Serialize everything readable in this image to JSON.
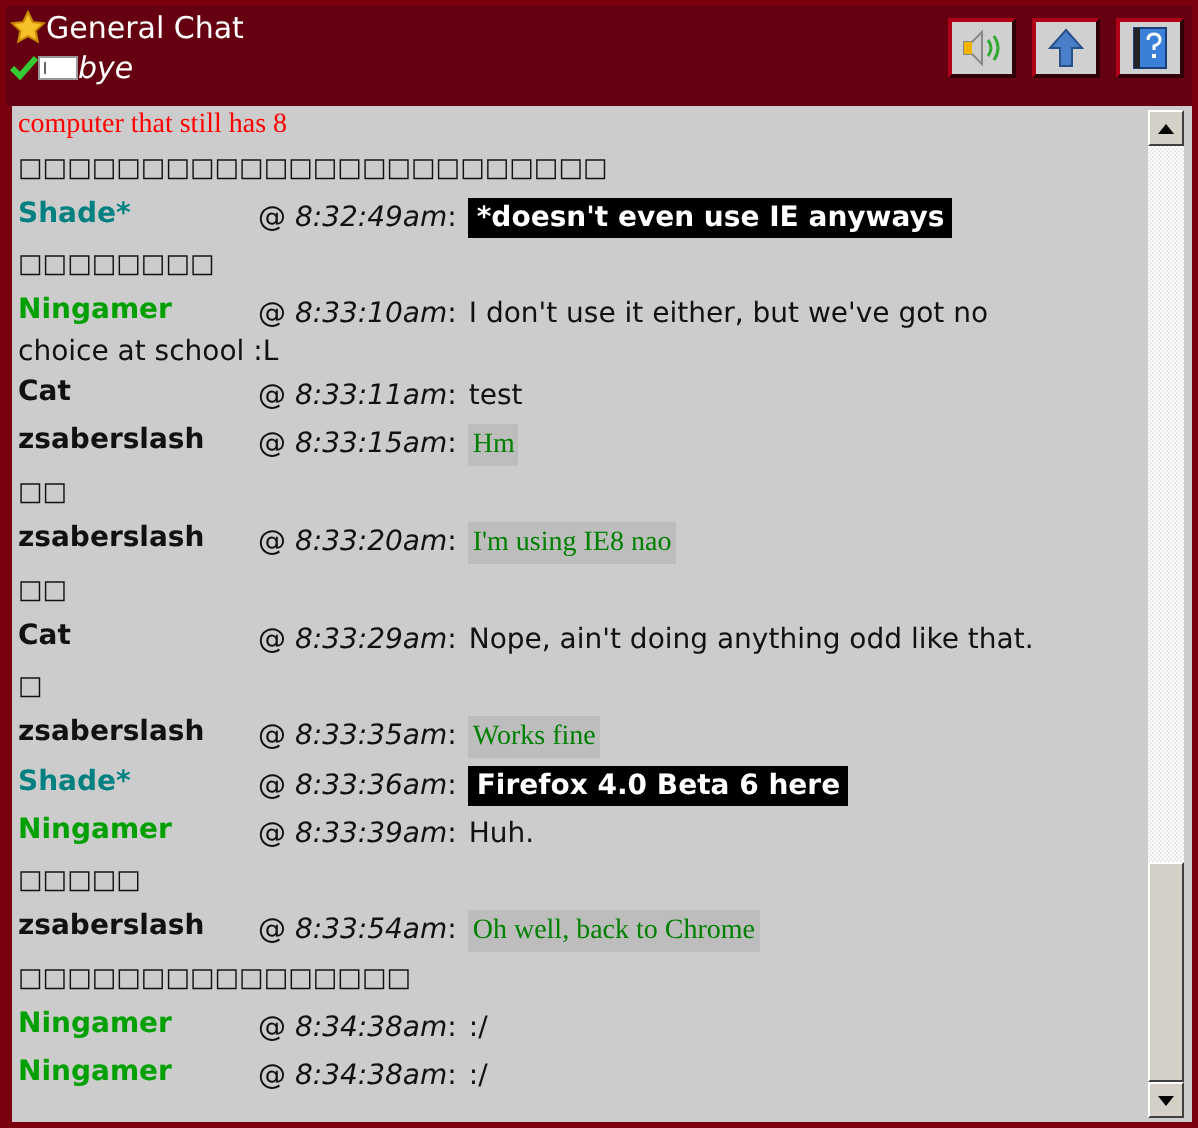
{
  "header": {
    "title": "General Chat",
    "status": {
      "online": true,
      "text": "bye"
    },
    "buttons": [
      {
        "kind": "sound"
      },
      {
        "kind": "up"
      },
      {
        "kind": "help"
      }
    ]
  },
  "lines": [
    {
      "kind": "note",
      "text": "computer that still has 8"
    },
    {
      "kind": "glyphs",
      "text": "□□□□□□□□□□□□□□□□□□□□□□□□"
    },
    {
      "kind": "highlight",
      "user": "Shade*",
      "color": "#008080",
      "time": "@ *8:32:49am*:",
      "text": "*doesn't even use IE anyways"
    },
    {
      "kind": "glyphs",
      "text": "□□□□□□□□"
    },
    {
      "kind": "plain",
      "user": "Ningamer",
      "color": "#00a000",
      "time": "@ *8:33:10am*:",
      "text": "I don't use it either, but we've got no",
      "continued": "choice at school :L"
    },
    {
      "kind": "plain",
      "user": "Cat",
      "color": "#111111",
      "time": "@ *8:33:11am*:",
      "text": "test"
    },
    {
      "kind": "serif",
      "user": "zsaberslash",
      "color": "#111111",
      "time": "@ *8:33:15am*:",
      "text": "Hm"
    },
    {
      "kind": "glyphs",
      "text": "□□"
    },
    {
      "kind": "serif",
      "user": "zsaberslash",
      "color": "#111111",
      "time": "@ *8:33:20am*:",
      "text": "I'm using IE8 nao"
    },
    {
      "kind": "glyphs",
      "text": "□□"
    },
    {
      "kind": "plain",
      "user": "Cat",
      "color": "#111111",
      "time": "@ *8:33:29am*:",
      "text": "Nope, ain't doing anything odd like that."
    },
    {
      "kind": "glyphs",
      "text": "□"
    },
    {
      "kind": "serif",
      "user": "zsaberslash",
      "color": "#111111",
      "time": "@ *8:33:35am*:",
      "text": "Works fine"
    },
    {
      "kind": "highlight",
      "user": "Shade*",
      "color": "#008080",
      "time": "@ *8:33:36am*:",
      "text": "Firefox 4.0 Beta 6 here"
    },
    {
      "kind": "plain",
      "user": "Ningamer",
      "color": "#00a000",
      "time": "@ *8:33:39am*:",
      "text": "Huh."
    },
    {
      "kind": "glyphs",
      "text": "□□□□□"
    },
    {
      "kind": "serif",
      "user": "zsaberslash",
      "color": "#111111",
      "time": "@ *8:33:54am*:",
      "text": "Oh well, back to Chrome"
    },
    {
      "kind": "glyphs",
      "text": "□□□□□□□□□□□□□□□□"
    },
    {
      "kind": "plain",
      "user": "Ningamer",
      "color": "#00a000",
      "time": "@ *8:34:38am*:",
      "text": ":/"
    },
    {
      "kind": "plain",
      "user": "Ningamer",
      "color": "#00a000",
      "time": "@ *8:34:38am*:",
      "text": ":/"
    }
  ]
}
